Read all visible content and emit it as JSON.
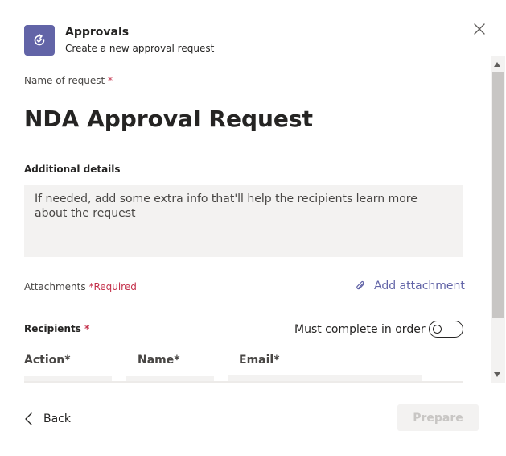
{
  "header": {
    "title": "Approvals",
    "subtitle": "Create a new approval request"
  },
  "form": {
    "name_label": "Name of request",
    "name_required_mark": "*",
    "name_value": "NDA Approval Request",
    "details_label": "Additional details",
    "details_placeholder": "If needed, add some extra info that'll help the recipients learn more about the request",
    "attachments_label": "Attachments",
    "attachments_required": "*Required",
    "add_attachment_label": "Add attachment",
    "recipients_label": "Recipients",
    "recipients_required_mark": "*",
    "must_complete_label": "Must complete in order",
    "must_complete_on": false,
    "columns": [
      "Action*",
      "Name*",
      "Email*"
    ]
  },
  "footer": {
    "back_label": "Back",
    "prepare_label": "Prepare"
  },
  "colors": {
    "accent": "#6264a7",
    "required": "#c4314b",
    "field_bg": "#f3f2f1"
  }
}
